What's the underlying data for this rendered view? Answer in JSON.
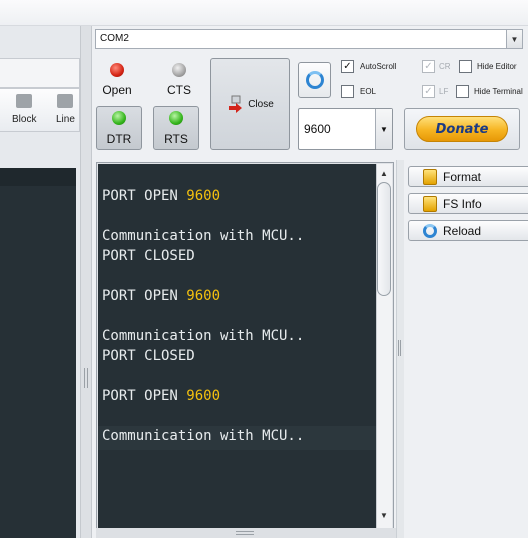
{
  "port": {
    "selected": "COM2"
  },
  "signals": {
    "open": {
      "label": "Open",
      "color": "#d42414"
    },
    "cts": {
      "label": "CTS",
      "color": "#a4a4a4"
    },
    "dtr": {
      "label": "DTR",
      "color": "#35b51c"
    },
    "rts": {
      "label": "RTS",
      "color": "#35b51c"
    }
  },
  "close_button": {
    "label": "Close"
  },
  "baud": {
    "selected": "9600"
  },
  "options": {
    "autoscroll": {
      "label": "AutoScroll",
      "checked": true
    },
    "eol": {
      "label": "EOL",
      "checked": false
    },
    "cr": {
      "label": "CR",
      "checked": true,
      "disabled": true
    },
    "lf": {
      "label": "LF",
      "checked": true,
      "disabled": true
    },
    "hide_editor": {
      "label": "Hide Editor",
      "checked": false
    },
    "hide_terminal": {
      "label": "Hide Terminal",
      "checked": false
    }
  },
  "donate": {
    "label": "Donate"
  },
  "toolbar": {
    "block_label": "Block",
    "line_label": "Line"
  },
  "terminal": {
    "lines": [
      {
        "text": "PORT OPEN ",
        "highlight": "9600"
      },
      {
        "text": "",
        "highlight": ""
      },
      {
        "text": "Communication with MCU..",
        "highlight": ""
      },
      {
        "text": "PORT CLOSED",
        "highlight": ""
      },
      {
        "text": "",
        "highlight": ""
      },
      {
        "text": "PORT OPEN ",
        "highlight": "9600"
      },
      {
        "text": "",
        "highlight": ""
      },
      {
        "text": "Communication with MCU..",
        "highlight": ""
      },
      {
        "text": "PORT CLOSED",
        "highlight": ""
      },
      {
        "text": "",
        "highlight": ""
      },
      {
        "text": "PORT OPEN ",
        "highlight": "9600"
      },
      {
        "text": "",
        "highlight": ""
      },
      {
        "text": "Communication with MCU..",
        "highlight": ""
      }
    ],
    "highlight_color": "#f4c10f",
    "background": "#263036"
  },
  "side_buttons": {
    "format": {
      "label": "Format"
    },
    "fs_info": {
      "label": "FS Info"
    },
    "reload": {
      "label": "Reload"
    }
  }
}
